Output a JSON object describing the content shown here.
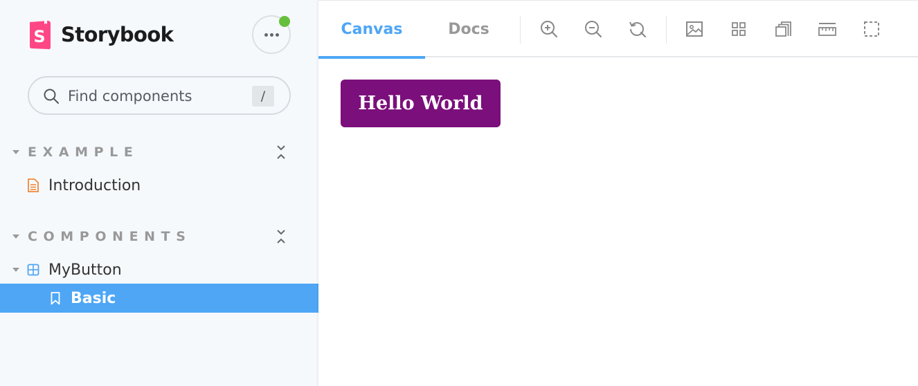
{
  "sidebar": {
    "brand": {
      "name": "Storybook",
      "logo_letter": "S"
    },
    "menu_button_icon": "ellipsis-icon",
    "search": {
      "placeholder": "Find components",
      "value": "",
      "shortcut": "/"
    },
    "sections": [
      {
        "label": "EXAMPLE",
        "items": [
          {
            "label": "Introduction",
            "icon": "document-icon"
          }
        ]
      },
      {
        "label": "COMPONENTS",
        "items": [
          {
            "label": "MyButton",
            "icon": "component-icon",
            "expanded": true,
            "children": [
              {
                "label": "Basic",
                "icon": "bookmark-icon",
                "selected": true
              }
            ]
          }
        ]
      }
    ]
  },
  "toolbar": {
    "tabs": [
      {
        "label": "Canvas",
        "active": true
      },
      {
        "label": "Docs",
        "active": false
      }
    ],
    "tools": [
      "zoom-in-icon",
      "zoom-out-icon",
      "zoom-reset-icon",
      "background-icon",
      "grid-icon",
      "viewport-icon",
      "measure-icon",
      "outline-icon"
    ]
  },
  "canvas": {
    "button_label": "Hello World"
  },
  "colors": {
    "accent": "#4ea6f5",
    "sidebar_bg": "#f6f9fc",
    "status_green": "#66bf3c",
    "storybook_pink": "#ff4785",
    "button_purple": "#7b0f7b",
    "doc_orange": "#f1883c",
    "section_gray": "#999999"
  }
}
